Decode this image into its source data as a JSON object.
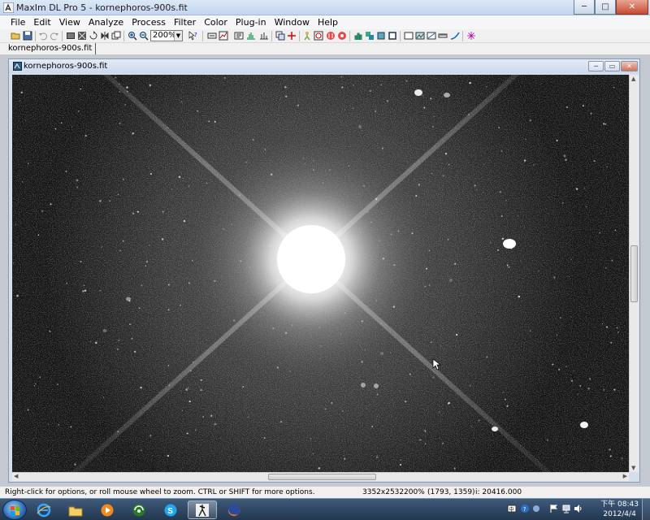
{
  "window": {
    "title": "MaxIm DL Pro 5 - kornephoros-900s.fit",
    "controls": {
      "minimize": "─",
      "maximize": "□",
      "close": "✕"
    }
  },
  "menu": [
    {
      "label": "File"
    },
    {
      "label": "Edit"
    },
    {
      "label": "View"
    },
    {
      "label": "Analyze"
    },
    {
      "label": "Process"
    },
    {
      "label": "Filter"
    },
    {
      "label": "Color"
    },
    {
      "label": "Plug-in"
    },
    {
      "label": "Window"
    },
    {
      "label": "Help"
    }
  ],
  "toolbar": {
    "zoom_value": "200%"
  },
  "doc_tabs": [
    {
      "label": "kornephoros-900s.fit"
    }
  ],
  "document": {
    "title": "kornephoros-900s.fit",
    "controls": {
      "minimize": "─",
      "restore": "▭",
      "close": "✕"
    }
  },
  "statusbar": {
    "hint": "Right-click for options, or roll mouse wheel to zoom. CTRL or SHIFT for more options.",
    "image_size": "3352x2532",
    "zoom": "200%",
    "cursor_position": "(1793, 1359)",
    "pixel_value": "i: 20416.000"
  },
  "taskbar": {
    "apps": [
      {
        "icon": "internet-explorer-icon"
      },
      {
        "icon": "file-explorer-icon"
      },
      {
        "icon": "media-player-icon"
      },
      {
        "icon": "media-center-icon"
      },
      {
        "icon": "skype-icon"
      },
      {
        "icon": "maxim-dl-icon",
        "active": true
      },
      {
        "icon": "firefox-icon"
      }
    ],
    "clock_time": "下午 08:43",
    "clock_date": "2012/4/4"
  },
  "colors": {
    "titlebar": "#c3d6ee",
    "image_background": "#151515",
    "taskbar": "#23374f"
  }
}
